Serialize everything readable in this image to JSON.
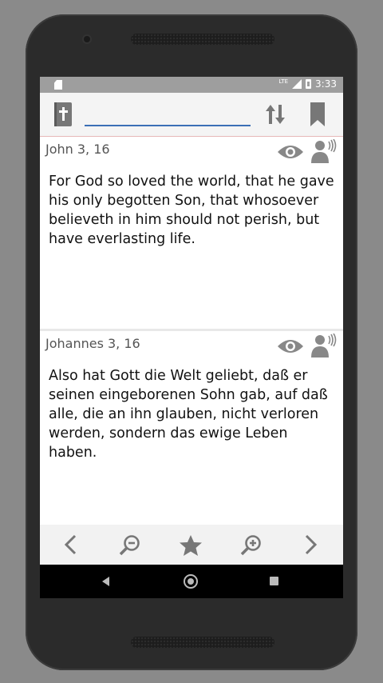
{
  "status_bar": {
    "network": "LTE",
    "time": "3:33"
  },
  "search": {
    "value": "",
    "placeholder": ""
  },
  "verses": [
    {
      "reference": "John 3, 16",
      "text": "For God so loved the world, that he gave his only begotten Son, that whosoever believeth in him should not perish, but have everlasting life."
    },
    {
      "reference": "Johannes 3, 16",
      "text": "Also hat Gott die Welt geliebt, daß er seinen eingeborenen Sohn gab, auf daß alle, die an ihn glauben, nicht verloren werden, sondern das ewige Leben haben."
    }
  ],
  "icons": {
    "toolbar": [
      "bible-icon",
      "sort-icon",
      "bookmark-icon"
    ],
    "verse_actions": [
      "eye-icon",
      "speak-icon"
    ],
    "bottom_bar": [
      "chevron-left-icon",
      "zoom-out-icon",
      "star-icon",
      "zoom-in-icon",
      "chevron-right-icon"
    ],
    "nav_bar": [
      "back-icon",
      "home-icon",
      "recents-icon"
    ]
  },
  "colors": {
    "accent": "#3b6fb6",
    "icon": "#777777",
    "status_bar": "#9e9e9e"
  }
}
